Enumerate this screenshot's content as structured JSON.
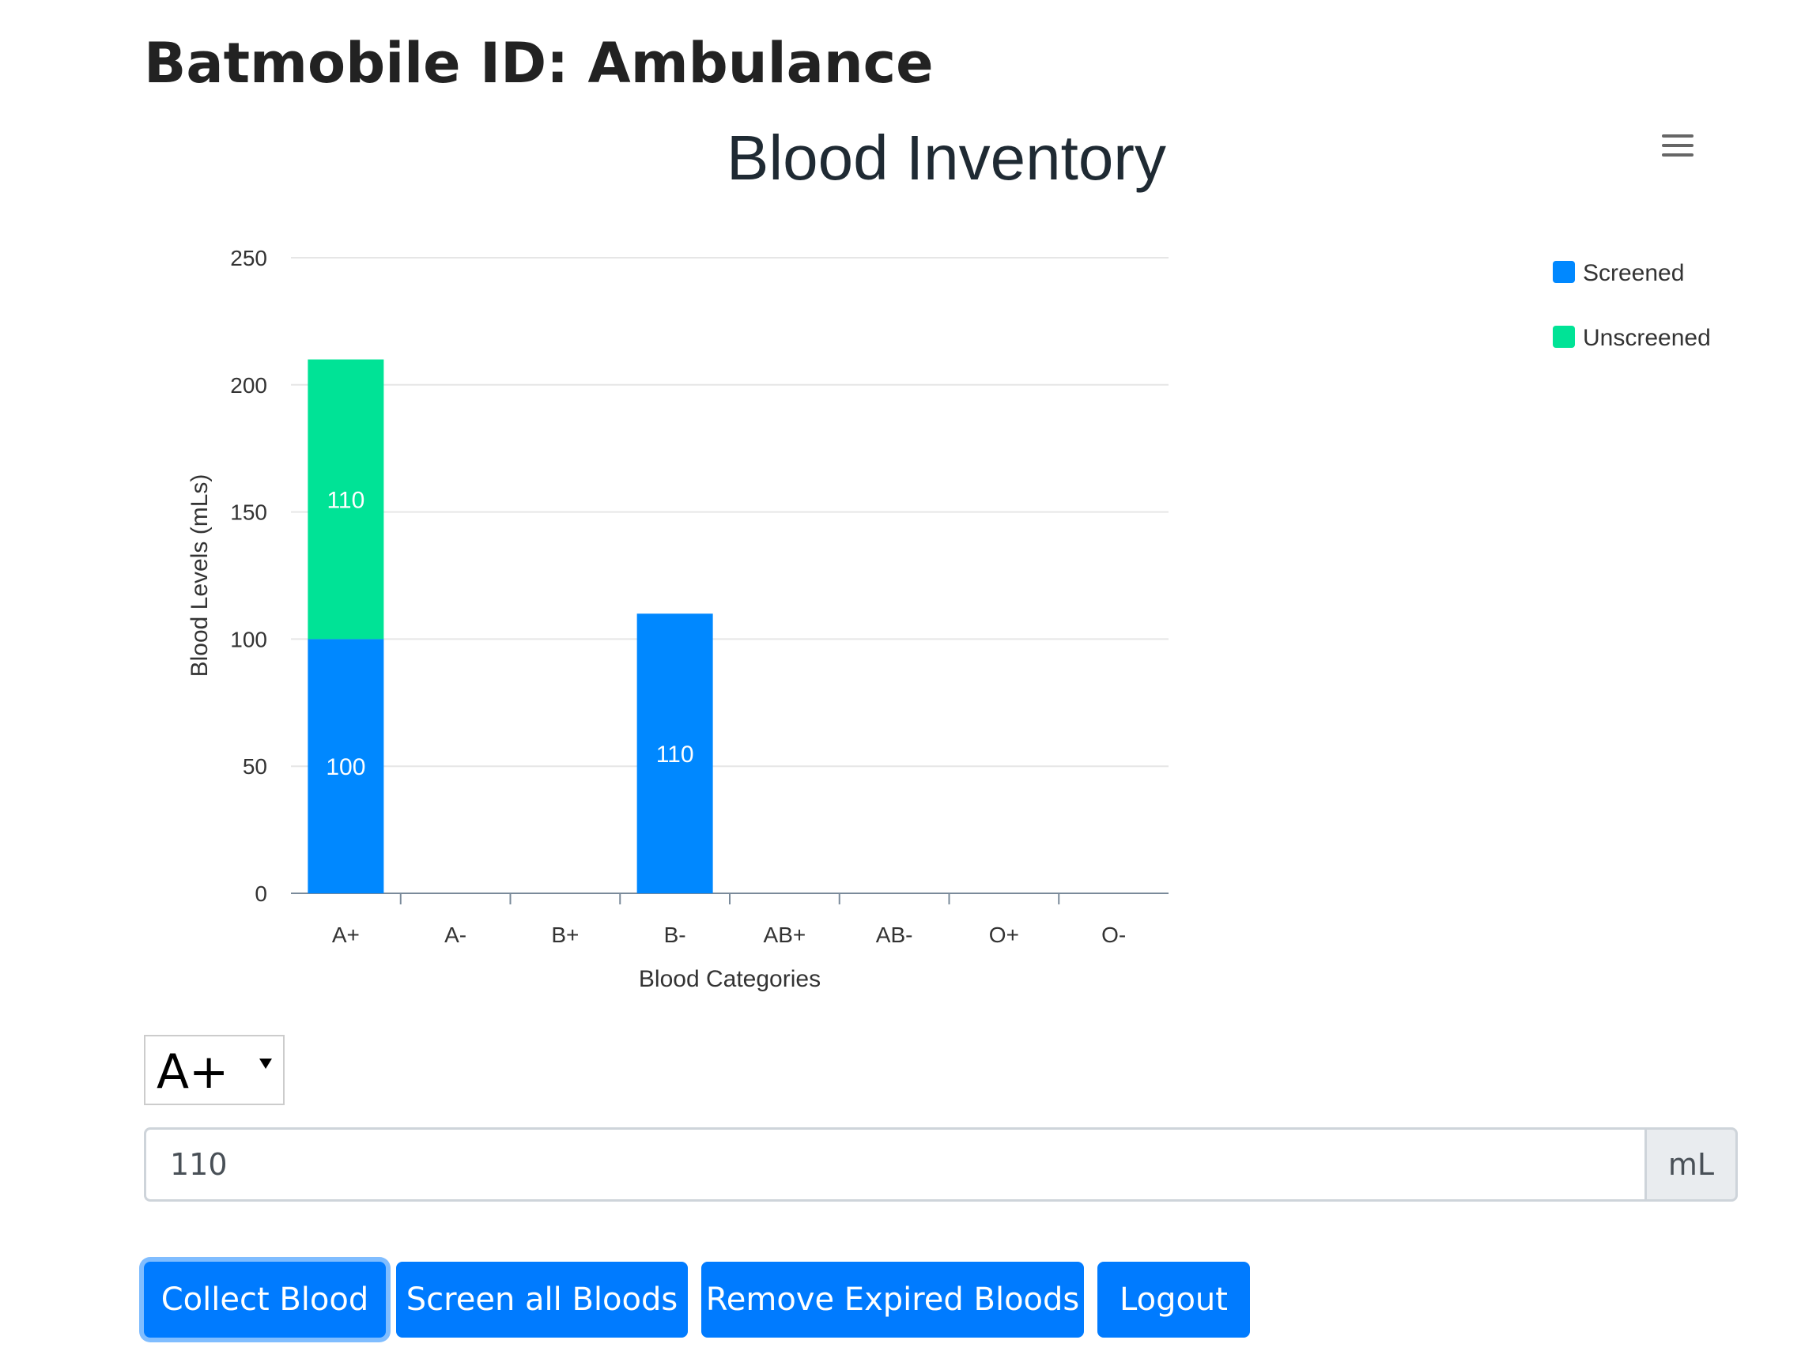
{
  "page": {
    "title": "Batmobile ID: Ambulance"
  },
  "chart_data": {
    "type": "bar",
    "stacked": true,
    "title": "Blood Inventory",
    "xlabel": "Blood Categories",
    "ylabel": "Blood Levels (mLs)",
    "categories": [
      "A+",
      "A-",
      "B+",
      "B-",
      "AB+",
      "AB-",
      "O+",
      "O-"
    ],
    "ylim": [
      0,
      250
    ],
    "yticks": [
      0,
      50,
      100,
      150,
      200,
      250
    ],
    "grid": true,
    "legend_position": "top-right",
    "series": [
      {
        "name": "Screened",
        "color": "#0088ff",
        "values": [
          100,
          0,
          0,
          110,
          0,
          0,
          0,
          0
        ]
      },
      {
        "name": "Unscreened",
        "color": "#00e396",
        "values": [
          110,
          0,
          0,
          0,
          0,
          0,
          0,
          0
        ]
      }
    ],
    "data_labels": true
  },
  "chart_menu": {
    "icon": "hamburger-menu-icon"
  },
  "form": {
    "blood_type_selected": "A+",
    "amount_value": "110",
    "unit": "mL"
  },
  "buttons": {
    "collect": "Collect Blood",
    "screen": "Screen all Bloods",
    "remove": "Remove Expired Bloods",
    "logout": "Logout"
  },
  "colors": {
    "primary": "#007bff",
    "focus_ring": "#80bdff"
  }
}
